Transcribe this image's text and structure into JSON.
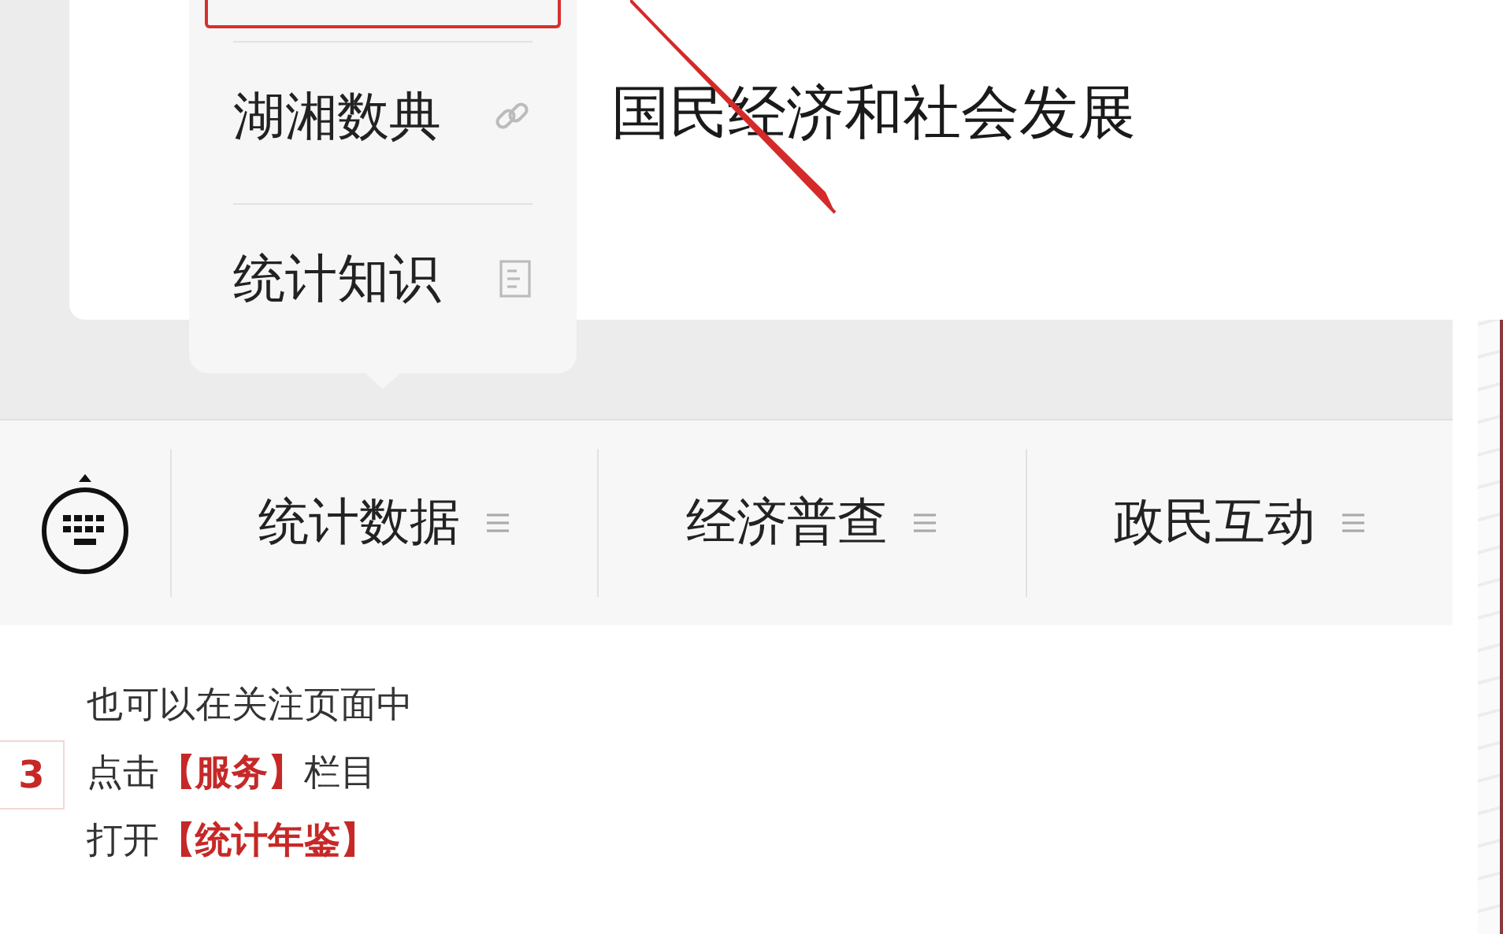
{
  "article_card": {
    "title": "国民经济和社会发展"
  },
  "popup_menu": {
    "items": [
      {
        "kind": "outlined"
      },
      {
        "kind": "link",
        "label": "湖湘数典"
      },
      {
        "kind": "document",
        "label": "统计知识"
      }
    ]
  },
  "menu_bar": {
    "items": [
      "统计数据",
      "经济普查",
      "政民互动"
    ]
  },
  "instructions": {
    "step_number": "3",
    "lines": [
      "也可以在关注页面中",
      "点击**【服务】**栏目",
      "打开**【统计年鉴】**"
    ]
  }
}
